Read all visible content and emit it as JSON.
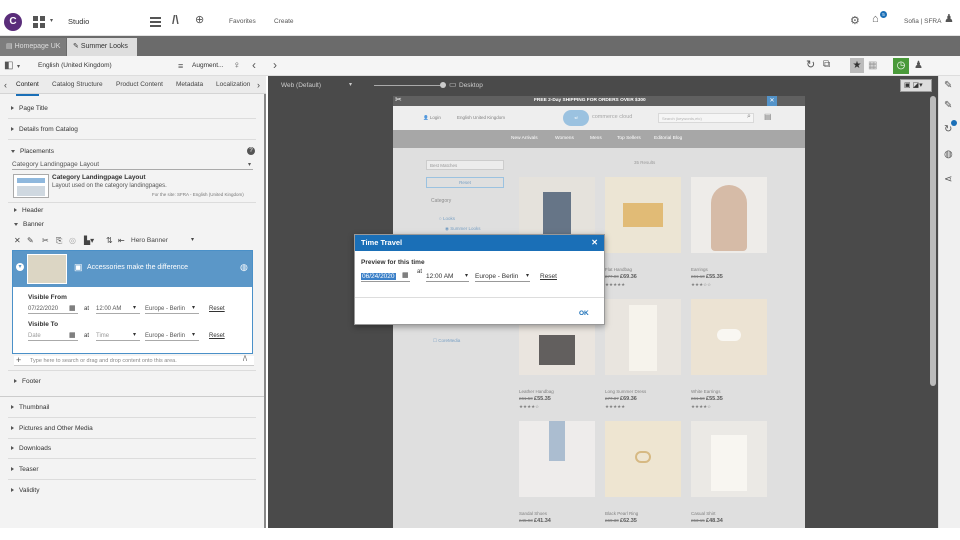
{
  "topbar": {
    "app_name": "Studio",
    "favorites": "Favorites",
    "create": "Create",
    "notif_count": "5",
    "user": "Sofia | SFRA"
  },
  "tabs": [
    {
      "label": "Homepage UK"
    },
    {
      "label": "Summer Looks"
    }
  ],
  "toolbar": {
    "locale": "English (United Kingdom)",
    "augment": "Augment...",
    "device": "Web (Default)",
    "desktop": "Desktop"
  },
  "content_tabs": [
    "Content",
    "Catalog Structure",
    "Product Content",
    "Metadata",
    "Localization"
  ],
  "sections": {
    "page_title": "Page Title",
    "details": "Details from Catalog",
    "placements": "Placements",
    "layout_select": "Category Landingpage Layout",
    "layout_title": "Category Landingpage Layout",
    "layout_desc": "Layout used on the category landingpages.",
    "layout_site": "For the site: SFRA - English (United Kingdom)",
    "header": "Header",
    "banner": "Banner",
    "hero_banner": "Hero Banner",
    "banner_item": "Accessories make the difference",
    "visible_from": "Visible From",
    "from_date": "07/22/2020",
    "at1": "at",
    "from_time": "12:00 AM",
    "from_tz": "Europe - Berlin",
    "reset1": "Reset",
    "visible_to": "Visible To",
    "to_date": "Date",
    "at2": "at",
    "to_time": "Time",
    "to_tz": "Europe - Berlin",
    "reset2": "Reset",
    "search_ph": "Type here to search or drag and drop content onto this area.",
    "footer": "Footer",
    "thumbnail": "Thumbnail",
    "pictures": "Pictures and Other Media",
    "downloads": "Downloads",
    "teaser": "Teaser",
    "validity": "Validity"
  },
  "shop": {
    "promo": "FREE 2-Day SHIPPING FOR ORDERS OVER $300",
    "login": "Login",
    "locale": "English United Kingdom",
    "brand": "commerce cloud",
    "search_ph": "Search (keywords,etc)",
    "nav": [
      "New Arrivals",
      "Womens",
      "Mens",
      "Top Sellers",
      "Editorial Blog"
    ],
    "sort": "Best Matches",
    "reset": "Reset",
    "category": "Category",
    "looks": "Looks",
    "summer_looks": "Summer Looks",
    "results": "35 Results",
    "coremedia": "CoreMedia",
    "products": [
      {
        "name": "Flat Handbag",
        "old": "£77.00",
        "price": "£69.36"
      },
      {
        "name": "Earrings",
        "old": "£61.10",
        "price": "£55.35"
      },
      {
        "name": "Leather Handbag",
        "old": "£61.50",
        "price": "£55.35"
      },
      {
        "name": "Long Summer Dress",
        "old": "£77.07",
        "price": "£69.36"
      },
      {
        "name": "White Earrings",
        "old": "£61.50",
        "price": "£55.35"
      },
      {
        "name": "Sandal Shoes",
        "old": "£45.93",
        "price": "£41.34"
      },
      {
        "name": "Black Pearl Ring",
        "old": "£69.30",
        "price": "£62.35"
      },
      {
        "name": "Casual Shirt",
        "old": "£53.15",
        "price": "£48.34"
      }
    ]
  },
  "modal": {
    "title": "Time Travel",
    "subtitle": "Preview for this time",
    "date": "06/24/2020",
    "at": "at",
    "time": "12:00 AM",
    "tz": "Europe - Berlin",
    "reset": "Reset",
    "ok": "OK"
  },
  "colors": {
    "accent": "#1a6fb7",
    "brand": "#5a2d7a",
    "banner_header": "#5b97c8"
  }
}
